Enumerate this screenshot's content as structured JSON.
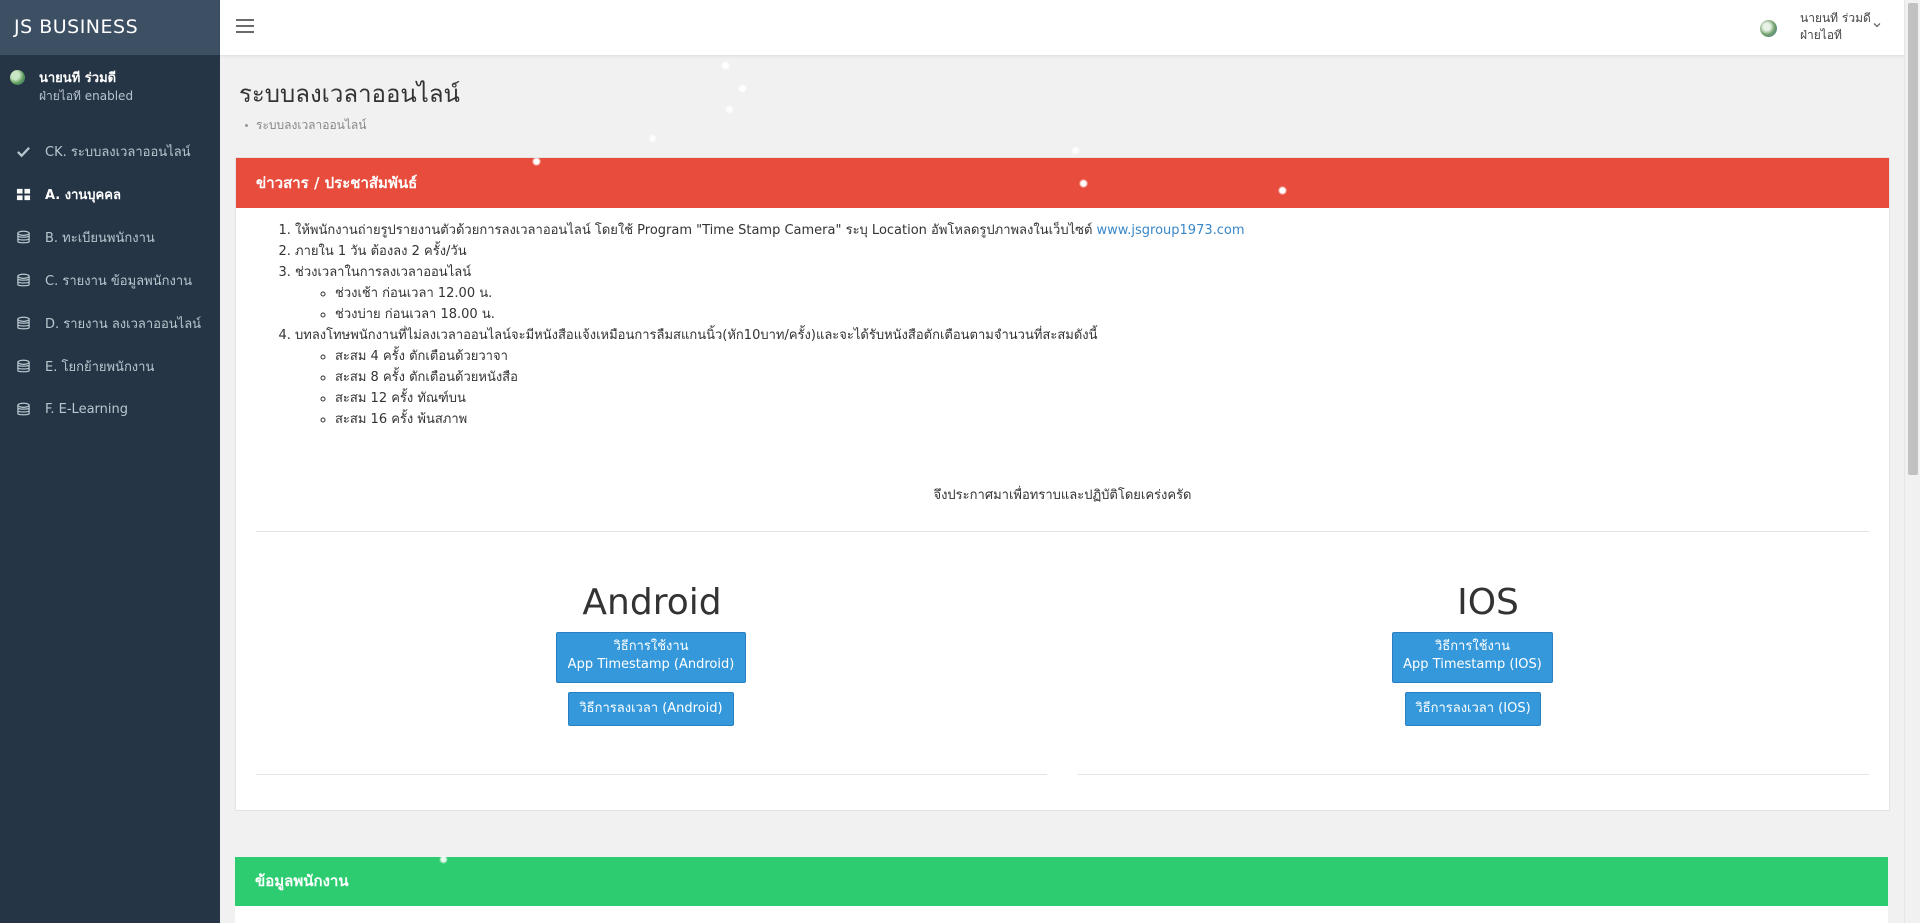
{
  "sidebar": {
    "brand": "JS  BUSINESS",
    "user": {
      "name": "นายนที ร่วมดี",
      "dept": "ฝ่ายไอที enabled"
    },
    "items": [
      {
        "label": "CK. ระบบลงเวลาออนไลน์",
        "icon": "check-icon"
      },
      {
        "label": "A. งานบุคคล",
        "icon": "dashboard-icon"
      },
      {
        "label": "B. ทะเบียนพนักงาน",
        "icon": "database-icon"
      },
      {
        "label": "C. รายงาน ข้อมูลพนักงาน",
        "icon": "database-icon"
      },
      {
        "label": "D. รายงาน ลงเวลาออนไลน์",
        "icon": "database-icon"
      },
      {
        "label": "E. โยกย้ายพนักงาน",
        "icon": "database-icon"
      },
      {
        "label": "F. E-Learning",
        "icon": "database-icon"
      }
    ]
  },
  "topbar": {
    "user_name": "นายนที ร่วมดี",
    "user_dept": "ฝ่ายไอที"
  },
  "page": {
    "title": "ระบบลงเวลาออนไลน์",
    "breadcrumb": "ระบบลงเวลาออนไลน์"
  },
  "news": {
    "header": "ข่าวสาร / ประชาสัมพันธ์",
    "item1_text": "ให้พนักงานถ่ายรูปรายงานตัวด้วยการลงเวลาออนไลน์ โดยใช้ Program \"Time Stamp Camera\" ระบุ Location อัพโหลดรูปภาพลงในเว็บไซต์ ",
    "item1_link": "www.jsgroup1973.com",
    "item2": "ภายใน 1 วัน ต้องลง 2 ครั้ง/วัน",
    "item3": "ช่วงเวลาในการลงเวลาออนไลน์",
    "item3_sub": [
      "ช่วงเช้า  ก่อนเวลา 12.00 น.",
      "ช่วงบ่าย ก่อนเวลา 18.00 น."
    ],
    "item4": "บทลงโทษพนักงานที่ไม่ลงเวลาออนไลน์จะมีหนังสือแจ้งเหมือนการลืมสแกนนิ้ว(หัก10บาท/ครั้ง)และจะได้รับหนังสือตักเตือนตามจำนวนที่สะสมดังนี้",
    "item4_sub": [
      "สะสม  4  ครั้ง ตักเตือนด้วยวาจา",
      "สะสม  8  ครั้ง ตักเตือนด้วยหนังสือ",
      "สะสม 12 ครั้ง ทัณฑ์บน",
      "สะสม 16 ครั้ง พ้นสภาพ"
    ],
    "closing": "จึงประกาศมาเพื่อทราบและปฏิบัติโดยเคร่งครัด"
  },
  "platforms": {
    "android": {
      "title": "Android",
      "guide_line1": "วิธีการใช้งาน",
      "guide_line2": "App Timestamp (Android)",
      "checkin": "วิธีการลงเวลา (Android)"
    },
    "ios": {
      "title": "IOS",
      "guide_line1": "วิธีการใช้งาน",
      "guide_line2": "App Timestamp (IOS)",
      "checkin": "วิธีการลงเวลา (IOS)"
    }
  },
  "employee_panel": {
    "header": "ข้อมูลพนักงาน"
  },
  "colors": {
    "sidebar_bg": "#263545",
    "news_header": "#e74c3c",
    "employee_header": "#2ecc71",
    "button": "#3498db",
    "link": "#3a87c8"
  }
}
